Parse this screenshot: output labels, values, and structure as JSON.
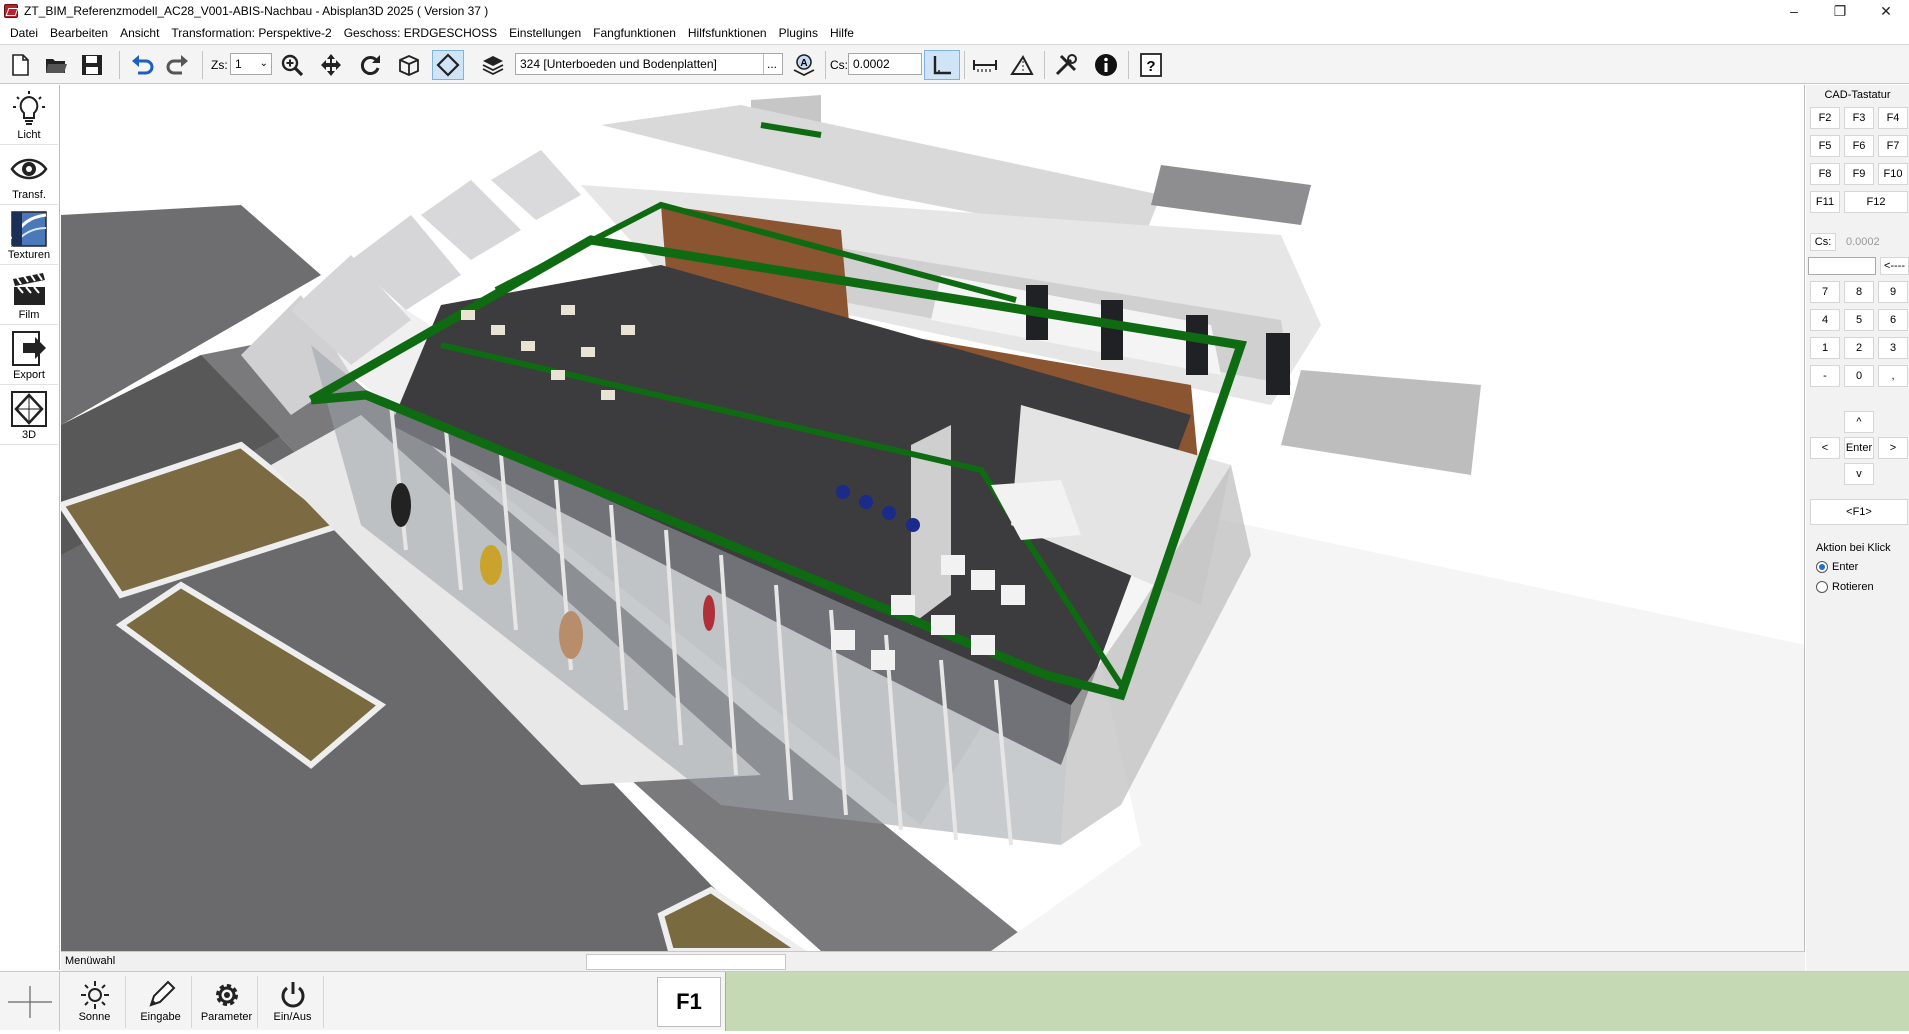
{
  "window": {
    "title": "ZT_BIM_Referenzmodell_AC28_V001-ABIS-Nachbau - Abisplan3D 2025 ( Version 37 )",
    "minimize": "–",
    "maximize": "❐",
    "close": "✕"
  },
  "menu": [
    "Datei",
    "Bearbeiten",
    "Ansicht",
    "Transformation: Perspektive-2",
    "Geschoss: ERDGESCHOSS",
    "Einstellungen",
    "Fangfunktionen",
    "Hilfsfunktionen",
    "Plugins",
    "Hilfe"
  ],
  "toolbar": {
    "zs_label": "Zs:",
    "zs_value": "1",
    "layer_value": "324 [Unterboeden und Bodenplatten]",
    "layer_more": "...",
    "cs_label": "Cs:",
    "cs_value": "0.0002",
    "icons": [
      "new-file-icon",
      "open-folder-icon",
      "save-icon",
      "undo-icon",
      "redo-icon",
      "zoom-icon",
      "pan-icon",
      "rotate-icon",
      "cube-icon",
      "plane-icon",
      "layers-icon",
      "autolayer-icon",
      "angle-icon",
      "measure-icon",
      "triangle-icon",
      "tools-icon",
      "info-icon",
      "help-icon"
    ]
  },
  "left_tools": [
    {
      "label": "Licht",
      "icon": "bulb-icon"
    },
    {
      "label": "Transf.",
      "icon": "eye-icon"
    },
    {
      "label": "Texturen",
      "icon": "texture-icon"
    },
    {
      "label": "Film",
      "icon": "clapper-icon"
    },
    {
      "label": "Export",
      "icon": "export-icon"
    },
    {
      "label": "3D",
      "icon": "3d-icon"
    }
  ],
  "cad_keyboard": {
    "title": "CAD-Tastatur",
    "fkeys_row1": [
      "F2",
      "F3",
      "F4"
    ],
    "fkeys_row2": [
      "F5",
      "F6",
      "F7"
    ],
    "fkeys_row3": [
      "F8",
      "F9",
      "F10"
    ],
    "fkeys_row4": [
      "F11",
      "F12"
    ],
    "cs_label": "Cs:",
    "cs_value": "0.0002",
    "backspace": "<----",
    "num_row1": [
      "7",
      "8",
      "9"
    ],
    "num_row2": [
      "4",
      "5",
      "6"
    ],
    "num_row3": [
      "1",
      "2",
      "3"
    ],
    "num_row4": [
      "-",
      "0",
      ","
    ],
    "up": "^",
    "left": "<",
    "enter": "Enter",
    "right": ">",
    "down": "v",
    "f1": "<F1>",
    "action_title": "Aktion bei Klick",
    "action_options": [
      "Enter",
      "Rotieren"
    ],
    "action_selected": "Enter"
  },
  "status": {
    "menu_label": "Menüwahl"
  },
  "bottom": {
    "buttons": [
      {
        "label": "Sonne",
        "icon": "sun-icon"
      },
      {
        "label": "Eingabe",
        "icon": "pencil-icon"
      },
      {
        "label": "Parameter",
        "icon": "gear-icon"
      },
      {
        "label": "Ein/Aus",
        "icon": "power-icon"
      }
    ],
    "f1": "F1"
  },
  "colors": {
    "highlight_green": "#0e6b12",
    "status_green": "#c5d9b5",
    "wood": "#8a5530",
    "floor": "#3c3b3e"
  }
}
